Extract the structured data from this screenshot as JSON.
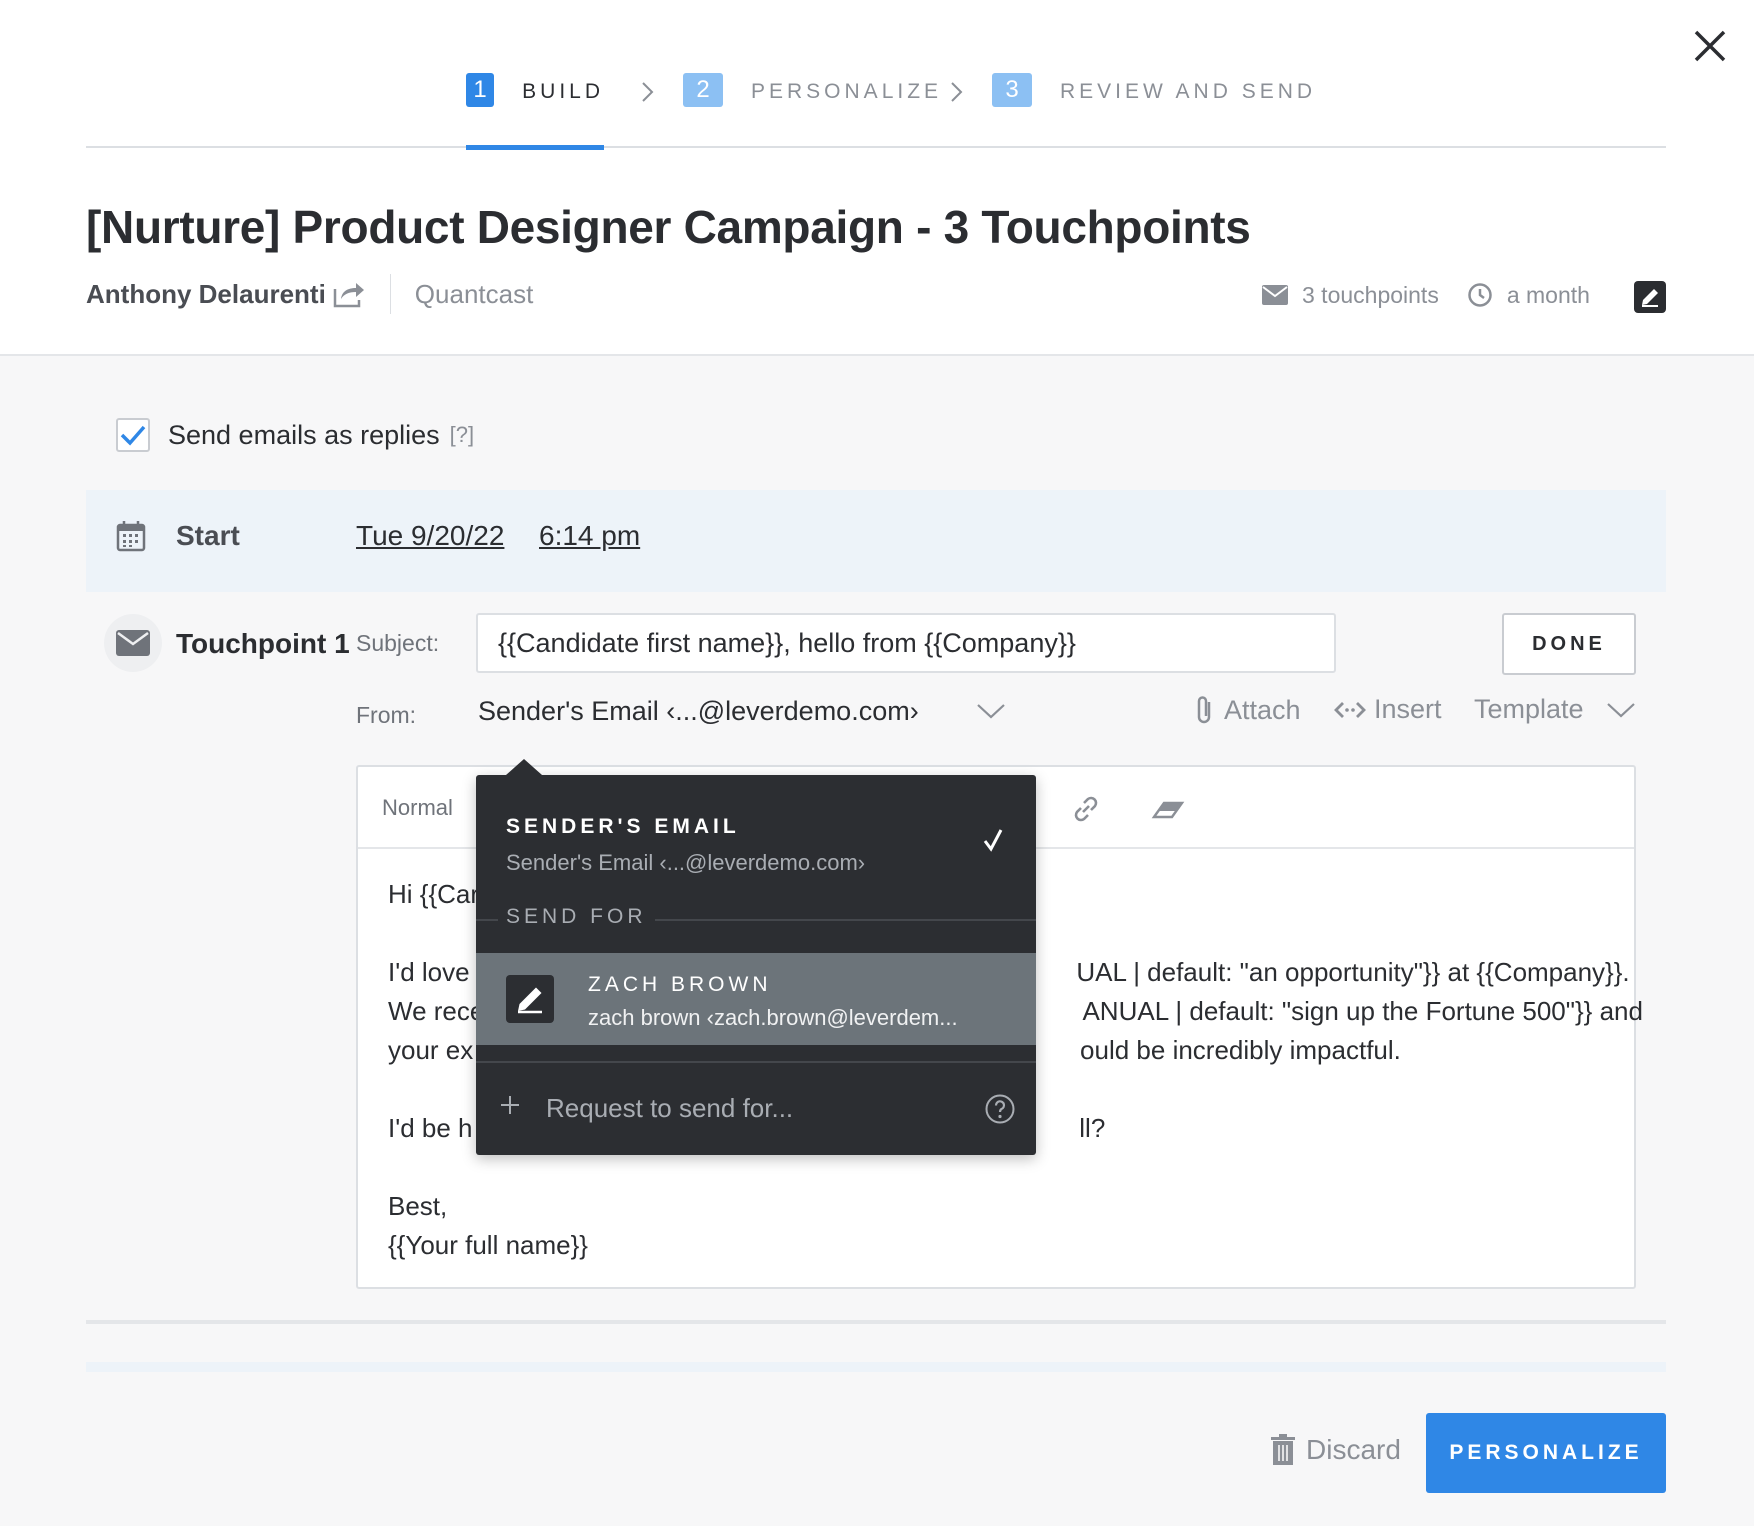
{
  "steps": [
    {
      "num": "1",
      "label": "BUILD"
    },
    {
      "num": "2",
      "label": "PERSONALIZE"
    },
    {
      "num": "3",
      "label": "REVIEW AND SEND"
    }
  ],
  "campaign": {
    "title": "[Nurture] Product Designer Campaign - 3 Touchpoints",
    "owner": "Anthony Delaurenti",
    "company": "Quantcast",
    "touchpoints_count": "3 touchpoints",
    "duration": "a month"
  },
  "reply_option": {
    "label": "Send emails as replies",
    "help": "[?]",
    "checked": true
  },
  "start": {
    "label": "Start",
    "date": "Tue 9/20/22",
    "time": "6:14 pm"
  },
  "touchpoint": {
    "title": "Touchpoint 1",
    "subject_label": "Subject:",
    "subject_value": "{{Candidate first name}}, hello from {{Company}}",
    "from_label": "From:",
    "from_value": "Sender's Email ‹...@leverdemo.com›",
    "done_label": "DONE",
    "attach_label": "Attach",
    "insert_label": "Insert",
    "template_label": "Template",
    "style_value": "Normal",
    "body_lines": [
      "Hi {{Car",
      "",
      "I'd love                                                                                    UAL | default: \"an opportunity\"}} at {{Company}}.",
      "We rece                                                                                   ANUAL | default: \"sign up the Fortune 500\"}} and",
      "your ex                                                                                    ould be incredibly impactful.",
      "",
      "I'd be h                                                                                    ll?",
      "",
      "Best,",
      "{{Your full name}}"
    ]
  },
  "dropdown": {
    "header": "SENDER'S EMAIL",
    "header_sub": "Sender's Email ‹...@leverdemo.com›",
    "section_label": "SEND FOR",
    "item_name": "ZACH BROWN",
    "item_email": "zach brown ‹zach.brown@leverdem...",
    "request_label": "Request to send for..."
  },
  "footer": {
    "discard_label": "Discard",
    "personalize_label": "PERSONALIZE"
  },
  "colors": {
    "accent": "#2f87e6",
    "accent_light": "#8cc0f3",
    "dropdown_bg": "#2c2e32",
    "dropdown_hover": "#6c747a"
  }
}
